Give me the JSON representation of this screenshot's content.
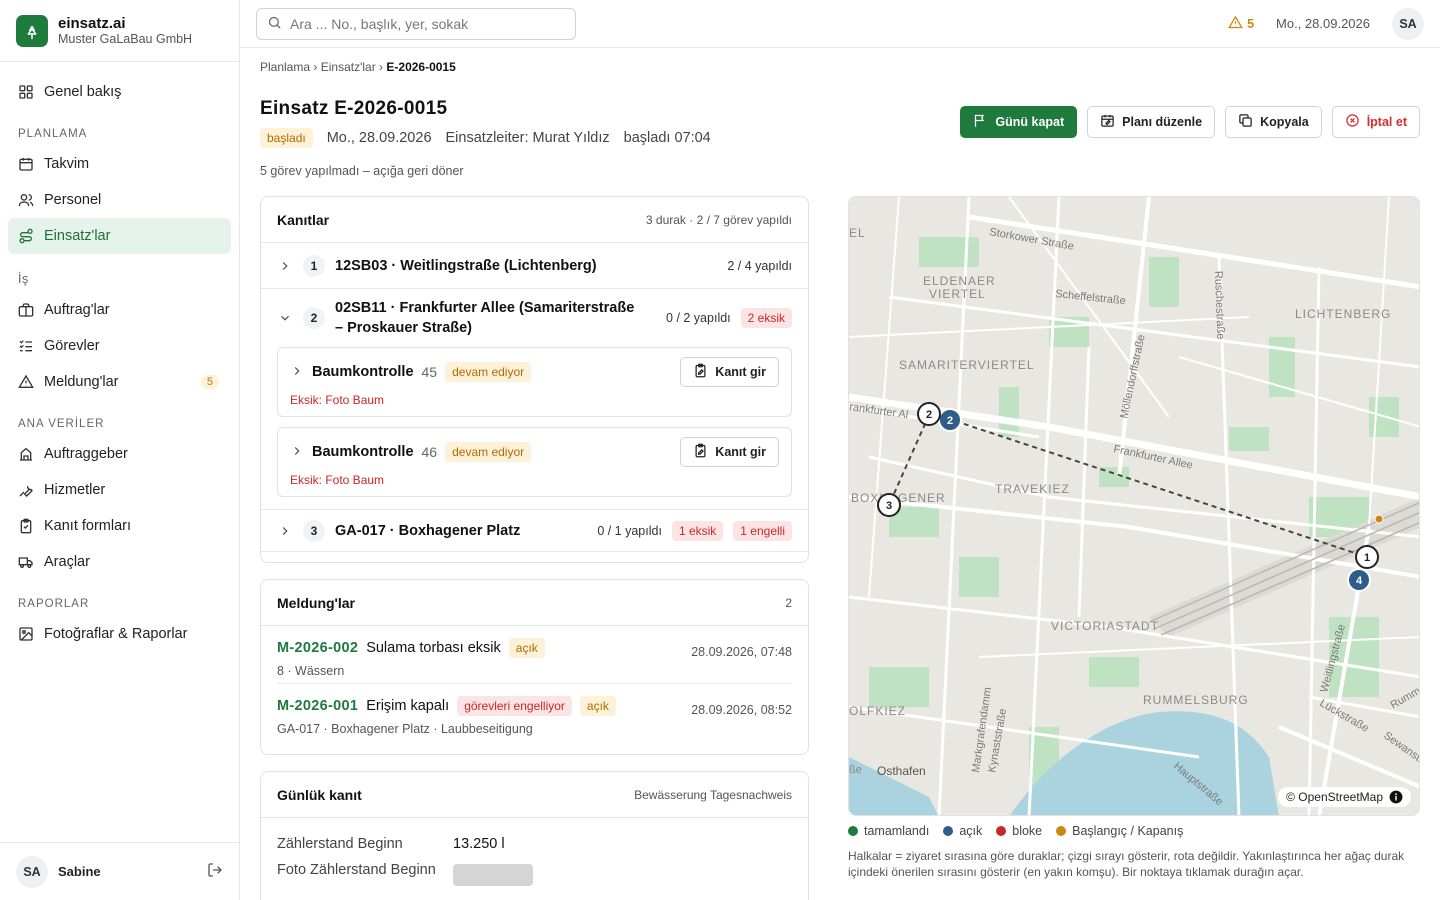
{
  "brand": {
    "name": "einsatz.ai",
    "company": "Muster GaLaBau GmbH"
  },
  "nav": {
    "overview": "Genel bakış",
    "sec_planning": "PLANLAMA",
    "calendar": "Takvim",
    "staff": "Personel",
    "jobs": "Einsatz'lar",
    "sec_work": "İş",
    "orders": "Auftrag'lar",
    "tasks": "Görevler",
    "reports": "Meldung'lar",
    "reports_badge": "5",
    "sec_master": "ANA VERİLER",
    "clients": "Auftraggeber",
    "services": "Hizmetler",
    "forms": "Kanıt formları",
    "vehicles": "Araçlar",
    "sec_reporting": "RAPORLAR",
    "photos": "Fotoğraflar & Raporlar"
  },
  "user": {
    "initials": "SA",
    "name": "Sabine"
  },
  "topbar": {
    "search_placeholder": "Ara ... No., başlık, yer, sokak",
    "alert_count": "5",
    "date": "Mo., 28.09.2026",
    "initials": "SA"
  },
  "breadcrumb": {
    "a": "Planlama",
    "b": "Einsatz'lar",
    "c": "E-2026-0015",
    "sep": "›"
  },
  "job": {
    "title": "Einsatz E-2026-0015",
    "status": "başladı",
    "date": "Mo., 28.09.2026",
    "leader": "Einsatzleiter: Murat Yıldız",
    "started": "başladı 07:04",
    "note": "5 görev yapılmadı – açığa geri döner"
  },
  "actions": {
    "close_day": "Günü kapat",
    "edit_plan": "Planı düzenle",
    "copy": "Kopyala",
    "cancel": "İptal et"
  },
  "evidence": {
    "title": "Kanıtlar",
    "summary": "3 durak · 2 / 7 görev yapıldı",
    "stops": [
      {
        "num": "1",
        "name": "12SB03 · Weitlingstraße (Lichtenberg)",
        "stat": "2 / 4 yapıldı"
      },
      {
        "num": "2",
        "name": "02SB11 · Frankfurter Allee (Samariterstraße – Proskauer Straße)",
        "stat": "0 / 2 yapıldı",
        "missing": "2 eksik"
      },
      {
        "num": "3",
        "name": "GA-017 · Boxhagener Platz",
        "stat": "0 / 1 yapıldı",
        "missing": "1 eksik",
        "blocked": "1 engelli"
      }
    ],
    "tasks": [
      {
        "name": "Baumkontrolle",
        "num": "45",
        "status": "devam ediyor",
        "missing": "Eksik: Foto Baum",
        "button": "Kanıt gir"
      },
      {
        "name": "Baumkontrolle",
        "num": "46",
        "status": "devam ediyor",
        "missing": "Eksik: Foto Baum",
        "button": "Kanıt gir"
      }
    ]
  },
  "meldungen": {
    "title": "Meldung'lar",
    "count": "2",
    "items": [
      {
        "id": "M-2026-002",
        "title": "Sulama torbası eksik",
        "status": "açık",
        "date": "28.09.2026, 07:48",
        "sub": "8 · Wässern"
      },
      {
        "id": "M-2026-001",
        "title": "Erişim kapalı",
        "flag": "görevleri engelliyor",
        "status": "açık",
        "date": "28.09.2026, 08:52",
        "sub": "GA-017 · Boxhagener Platz · Laubbeseitigung"
      }
    ]
  },
  "daily": {
    "title": "Günlük kanıt",
    "form": "Bewässerung Tagesnachweis",
    "rows": [
      {
        "k": "Zählerstand Beginn",
        "v": "13.250 l"
      },
      {
        "k": "Foto Zählerstand Beginn"
      }
    ]
  },
  "map": {
    "attribution": "© OpenStreetMap",
    "labels": {
      "eldenaer1": "ELDENAER",
      "eldenaer2": "VIERTEL",
      "samariter": "SAMARITERVIERTEL",
      "lichtenberg": "LICHTENBERG",
      "boxhagener": "BOXHAGENER",
      "travekiez": "TRAVEKIEZ",
      "victoriastadt": "VICTORIASTADT",
      "rummelsburg": "RUMMELSBURG",
      "rolfkiez": "OLFKIEZ",
      "osthafen": "Osthafen",
      "storkower": "Storkower Straße",
      "scheffel": "Scheffelstraße",
      "rusche": "Ruschestraße",
      "frankfurter": "Frankfurter Allee",
      "frankfurter2": "rankfurter Al",
      "moellendorff": "Möllendorffstraße",
      "weitling": "Weitlingstraße",
      "lueck": "Lückstraße",
      "haupt": "Hauptstraße",
      "sewan": "Sewanstra",
      "rumme": "Rumme",
      "markgrafen": "Markgrafendamm",
      "kynast": "Kynaststraße",
      "el": "EL",
      "ae": "ße"
    },
    "markers": {
      "m1": "1",
      "m2a": "2",
      "m2b": "2",
      "m3": "3",
      "m4": "4"
    }
  },
  "legend": {
    "done": "tamamlandı",
    "open": "açık",
    "blocked": "bloke",
    "startend": "Başlangıç / Kapanış",
    "colors": {
      "done": "#1f7a3d",
      "open": "#2f5d8a",
      "blocked": "#c62828",
      "startend": "#c98a12"
    }
  },
  "map_note": "Halkalar = ziyaret sırasına göre duraklar; çizgi sırayı gösterir, rota değildir. Yakınlaştırınca her ağaç durak içindeki önerilen sırasını gösterir (en yakın komşu). Bir noktaya tıklamak durağın açar."
}
